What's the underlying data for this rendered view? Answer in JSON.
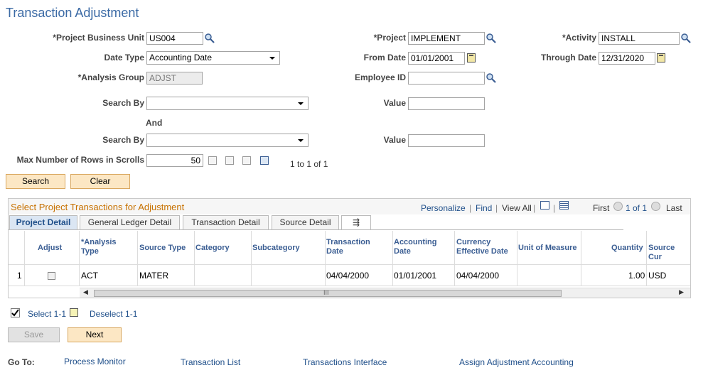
{
  "page": {
    "title": "Transaction Adjustment"
  },
  "form": {
    "project_business_unit": {
      "label": "*Project Business Unit",
      "value": "US004"
    },
    "project": {
      "label": "*Project",
      "value": "IMPLEMENT"
    },
    "activity": {
      "label": "*Activity",
      "value": "INSTALL"
    },
    "date_type": {
      "label": "Date Type",
      "value": "Accounting Date"
    },
    "from_date": {
      "label": "From Date",
      "value": "01/01/2001"
    },
    "through_date": {
      "label": "Through Date",
      "value": "12/31/2020"
    },
    "analysis_group": {
      "label": "*Analysis Group",
      "value": "ADJST"
    },
    "employee_id": {
      "label": "Employee ID",
      "value": ""
    },
    "search_by_1": {
      "label": "Search By",
      "value": ""
    },
    "value_1": {
      "label": "Value",
      "value": ""
    },
    "and_label": "And",
    "search_by_2": {
      "label": "Search By",
      "value": ""
    },
    "value_2": {
      "label": "Value",
      "value": ""
    },
    "max_rows": {
      "label": "Max Number of Rows in Scrolls",
      "value": "50"
    },
    "row_count": "1 to 1 of 1"
  },
  "buttons": {
    "search": "Search",
    "clear": "Clear",
    "save": "Save",
    "next": "Next"
  },
  "grid": {
    "title": "Select Project Transactions for Adjustment",
    "toolbar": {
      "personalize": "Personalize",
      "find": "Find",
      "view_all": "View All",
      "first": "First",
      "pager": "1 of 1",
      "last": "Last",
      "sep": "|"
    },
    "tabs": [
      "Project Detail",
      "General Ledger Detail",
      "Transaction Detail",
      "Source Detail"
    ],
    "columns": [
      "Adjust",
      "*Analysis Type",
      "Source Type",
      "Category",
      "Subcategory",
      "Transaction Date",
      "Accounting Date",
      "Currency Effective Date",
      "Unit of Measure",
      "Quantity",
      "Source Cur"
    ],
    "rows": [
      {
        "num": "1",
        "adjust": false,
        "analysis_type": "ACT",
        "source_type": "MATER",
        "category": "",
        "subcategory": "",
        "transaction_date": "04/04/2000",
        "accounting_date": "01/01/2001",
        "currency_effective_date": "04/04/2000",
        "unit_of_measure": "",
        "quantity": "1.00",
        "source_currency": "USD"
      }
    ],
    "scroll_mark": "III"
  },
  "select_links": {
    "select": "Select 1-1",
    "deselect": "Deselect 1-1"
  },
  "goto": {
    "label": "Go To:",
    "links": [
      "Process Monitor",
      "Transaction List",
      "Transactions Interface",
      "Assign Adjustment Accounting"
    ]
  },
  "colors": {
    "title": "#3b6aa5",
    "link": "#1f4f8a",
    "grid_title": "#c77100",
    "button_bg": "#fce7c4"
  }
}
